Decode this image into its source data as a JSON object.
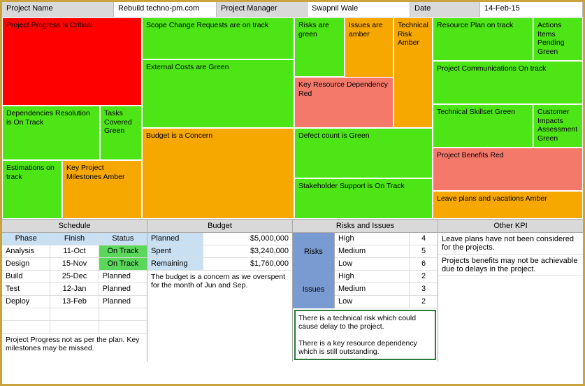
{
  "header": {
    "projectNameLabel": "Project Name",
    "projectName": "Rebuild techno-pm.com",
    "projectManagerLabel": "Project Manager",
    "projectManager": "Swapnil Wale",
    "dateLabel": "Date",
    "date": "14-Feb-15"
  },
  "tiles": {
    "progress": "Project Progress is Critical",
    "scope": "Scope Change Requests are on track",
    "risks": "Risks are green",
    "issues": "Issues are amber",
    "techRisk": "Technical Risk Amber",
    "resourcePlan": "Resource Plan on track",
    "actions": "Actions Items Pending Green",
    "external": "External Costs are Green",
    "keyResource": "Key Resource Dependency Red",
    "comms": "Project Communications On track",
    "dependencies": "Dependencies Resolution is On Track",
    "tasks": "Tasks Covered Green",
    "budget": "Budget is a Concern",
    "defect": "Defect count is Green",
    "skillset": "Technical Skillset Green",
    "customer": "Customer Impacts Assessment Green",
    "estimations": "Estimations on track",
    "milestones": "Key Project Milestones Amber",
    "stakeholder": "Stakeholder Support is On Track",
    "benefits": "Project Benefits Red",
    "leave": "Leave plans and vacations Amber"
  },
  "sectionHeaders": {
    "schedule": "Schedule",
    "budget": "Budget",
    "risks": "Risks and Issues",
    "kpi": "Other KPI"
  },
  "schedule": {
    "cols": {
      "phase": "Phase",
      "finish": "Finish",
      "status": "Status"
    },
    "rows": [
      {
        "phase": "Analysis",
        "finish": "11-Oct",
        "status": "On Track",
        "ontrack": true
      },
      {
        "phase": "Design",
        "finish": "15-Nov",
        "status": "On Track",
        "ontrack": true
      },
      {
        "phase": "Build",
        "finish": "25-Dec",
        "status": "Planned",
        "ontrack": false
      },
      {
        "phase": "Test",
        "finish": "12-Jan",
        "status": "Planned",
        "ontrack": false
      },
      {
        "phase": "Deploy",
        "finish": "13-Feb",
        "status": "Planned",
        "ontrack": false
      }
    ],
    "note": "Project Progress not as per the plan. Key milestones may be missed."
  },
  "budget": {
    "rows": [
      {
        "label": "Planned",
        "value": "$5,000,000"
      },
      {
        "label": "Spent",
        "value": "$3,240,000"
      },
      {
        "label": "Remaining",
        "value": "$1,760,000"
      }
    ],
    "note": "The budget is a concern as we overspent for the month of Jun and Sep."
  },
  "risksIssues": {
    "risksLabel": "Risks",
    "issuesLabel": "Issues",
    "risks": [
      {
        "level": "High",
        "count": "4"
      },
      {
        "level": "Medium",
        "count": "5"
      },
      {
        "level": "Low",
        "count": "6"
      }
    ],
    "issues": [
      {
        "level": "High",
        "count": "2"
      },
      {
        "level": "Medium",
        "count": "3"
      },
      {
        "level": "Low",
        "count": "2"
      }
    ],
    "note": "There is a technical risk which could cause delay to the project.\n\nThere is a key resource dependency which is still outstanding."
  },
  "kpi": {
    "notes": [
      "Leave plans have not been considered for the projects.",
      "Projects benefits may not be achievable due to delays in the project."
    ]
  }
}
